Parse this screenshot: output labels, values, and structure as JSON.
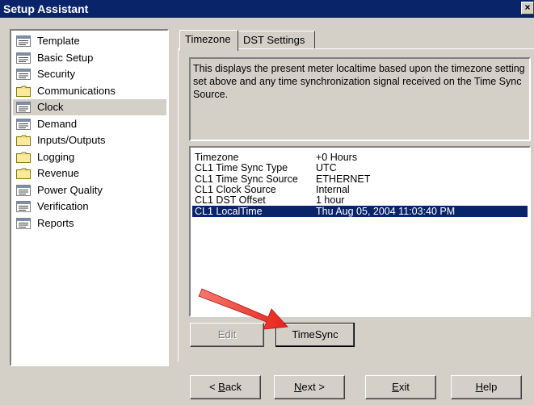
{
  "window": {
    "title": "Setup Assistant",
    "close_glyph": "×"
  },
  "sidebar": {
    "items": [
      {
        "label": "Template",
        "icon": "document-icon"
      },
      {
        "label": "Basic Setup",
        "icon": "document-icon"
      },
      {
        "label": "Security",
        "icon": "document-icon"
      },
      {
        "label": "Communications",
        "icon": "folder-icon"
      },
      {
        "label": "Clock",
        "icon": "document-icon",
        "selected": true
      },
      {
        "label": "Demand",
        "icon": "document-icon"
      },
      {
        "label": "Inputs/Outputs",
        "icon": "folder-icon"
      },
      {
        "label": "Logging",
        "icon": "folder-icon"
      },
      {
        "label": "Revenue",
        "icon": "folder-icon"
      },
      {
        "label": "Power Quality",
        "icon": "document-icon"
      },
      {
        "label": "Verification",
        "icon": "document-icon"
      },
      {
        "label": "Reports",
        "icon": "document-icon"
      }
    ]
  },
  "tabs": [
    {
      "label": "Timezone",
      "active": true
    },
    {
      "label": "DST Settings",
      "active": false
    }
  ],
  "description": "This displays the present meter localtime based upon the timezone setting set above and any time synchronization signal received on the Time Sync Source.",
  "settings": {
    "rows": [
      {
        "name": "Timezone",
        "value": "+0 Hours"
      },
      {
        "name": "CL1 Time Sync Type",
        "value": "UTC"
      },
      {
        "name": "CL1 Time Sync Source",
        "value": "ETHERNET"
      },
      {
        "name": "CL1 Clock Source",
        "value": "Internal"
      },
      {
        "name": "CL1 DST Offset",
        "value": "1 hour"
      },
      {
        "name": "CL1 LocalTime",
        "value": "Thu Aug 05, 2004 11:03:40 PM",
        "selected": true
      }
    ]
  },
  "buttons": {
    "edit": "Edit",
    "timesync": "TimeSync",
    "back_prefix": "< ",
    "back_key": "B",
    "back_rest": "ack",
    "next_key": "N",
    "next_rest": "ext >",
    "exit_key": "E",
    "exit_rest": "xit",
    "help_key": "H",
    "help_rest": "elp"
  },
  "colors": {
    "titlebar": "#0a246a",
    "face": "#d4d0c8",
    "selection": "#0a246a",
    "arrow": "#e8221a"
  }
}
